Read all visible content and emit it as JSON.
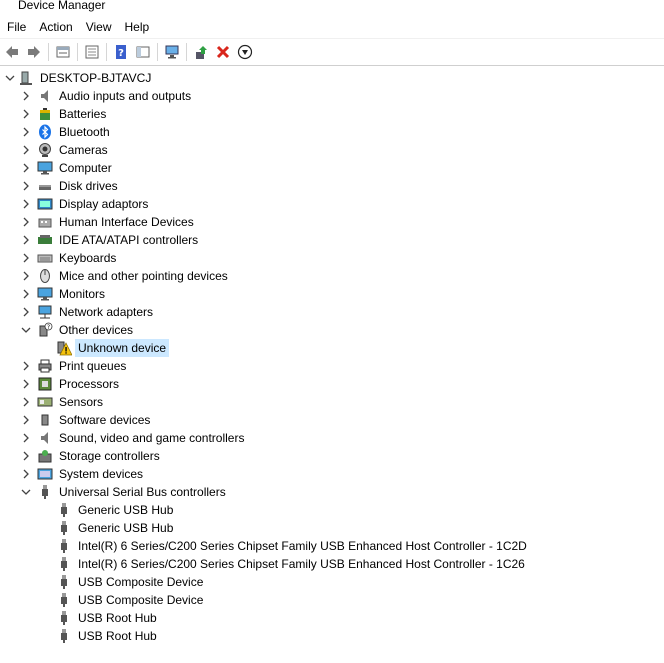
{
  "window": {
    "title": "Device Manager"
  },
  "menu": [
    "File",
    "Action",
    "View",
    "Help"
  ],
  "toolbar": [
    {
      "icon": "back-arrow-icon"
    },
    {
      "icon": "forward-arrow-icon"
    },
    {
      "sep": true
    },
    {
      "icon": "properties-icon"
    },
    {
      "sep": true
    },
    {
      "icon": "console-tree-icon"
    },
    {
      "sep": true
    },
    {
      "icon": "help-icon"
    },
    {
      "icon": "scope-pane-icon"
    },
    {
      "sep": true
    },
    {
      "icon": "scan-hardware-icon"
    },
    {
      "sep": true
    },
    {
      "icon": "update-driver-icon"
    },
    {
      "icon": "uninstall-device-icon"
    },
    {
      "icon": "disable-device-icon"
    }
  ],
  "tree": [
    {
      "level": 0,
      "label": "DESKTOP-BJTAVCJ",
      "icon": "computer-root-icon",
      "chevron": "down"
    },
    {
      "level": 1,
      "label": "Audio inputs and outputs",
      "icon": "speaker-icon",
      "chevron": "right"
    },
    {
      "level": 1,
      "label": "Batteries",
      "icon": "battery-icon",
      "chevron": "right"
    },
    {
      "level": 1,
      "label": "Bluetooth",
      "icon": "bluetooth-icon",
      "chevron": "right"
    },
    {
      "level": 1,
      "label": "Cameras",
      "icon": "camera-icon",
      "chevron": "right"
    },
    {
      "level": 1,
      "label": "Computer",
      "icon": "computer-icon",
      "chevron": "right"
    },
    {
      "level": 1,
      "label": "Disk drives",
      "icon": "disk-drive-icon",
      "chevron": "right"
    },
    {
      "level": 1,
      "label": "Display adaptors",
      "icon": "display-adapter-icon",
      "chevron": "right"
    },
    {
      "level": 1,
      "label": "Human Interface Devices",
      "icon": "hid-icon",
      "chevron": "right"
    },
    {
      "level": 1,
      "label": "IDE ATA/ATAPI controllers",
      "icon": "ide-controller-icon",
      "chevron": "right"
    },
    {
      "level": 1,
      "label": "Keyboards",
      "icon": "keyboard-icon",
      "chevron": "right"
    },
    {
      "level": 1,
      "label": "Mice and other pointing devices",
      "icon": "mouse-icon",
      "chevron": "right"
    },
    {
      "level": 1,
      "label": "Monitors",
      "icon": "monitor-icon",
      "chevron": "right"
    },
    {
      "level": 1,
      "label": "Network adapters",
      "icon": "network-adapter-icon",
      "chevron": "right"
    },
    {
      "level": 1,
      "label": "Other devices",
      "icon": "other-devices-icon",
      "chevron": "down"
    },
    {
      "level": 2,
      "label": "Unknown device",
      "icon": "unknown-device-warning-icon",
      "selected": true
    },
    {
      "level": 1,
      "label": "Print queues",
      "icon": "printer-icon",
      "chevron": "right"
    },
    {
      "level": 1,
      "label": "Processors",
      "icon": "processor-icon",
      "chevron": "right"
    },
    {
      "level": 1,
      "label": "Sensors",
      "icon": "sensor-icon",
      "chevron": "right"
    },
    {
      "level": 1,
      "label": "Software devices",
      "icon": "software-device-icon",
      "chevron": "right"
    },
    {
      "level": 1,
      "label": "Sound, video and game controllers",
      "icon": "sound-icon",
      "chevron": "right"
    },
    {
      "level": 1,
      "label": "Storage controllers",
      "icon": "storage-controller-icon",
      "chevron": "right"
    },
    {
      "level": 1,
      "label": "System devices",
      "icon": "system-devices-icon",
      "chevron": "right"
    },
    {
      "level": 1,
      "label": "Universal Serial Bus controllers",
      "icon": "usb-icon",
      "chevron": "down"
    },
    {
      "level": 2,
      "label": "Generic USB Hub",
      "icon": "usb-icon"
    },
    {
      "level": 2,
      "label": "Generic USB Hub",
      "icon": "usb-icon"
    },
    {
      "level": 2,
      "label": "Intel(R) 6 Series/C200 Series Chipset Family USB Enhanced Host Controller - 1C2D",
      "icon": "usb-icon"
    },
    {
      "level": 2,
      "label": "Intel(R) 6 Series/C200 Series Chipset Family USB Enhanced Host Controller - 1C26",
      "icon": "usb-icon"
    },
    {
      "level": 2,
      "label": "USB Composite Device",
      "icon": "usb-icon"
    },
    {
      "level": 2,
      "label": "USB Composite Device",
      "icon": "usb-icon"
    },
    {
      "level": 2,
      "label": "USB Root Hub",
      "icon": "usb-icon"
    },
    {
      "level": 2,
      "label": "USB Root Hub",
      "icon": "usb-icon"
    }
  ]
}
